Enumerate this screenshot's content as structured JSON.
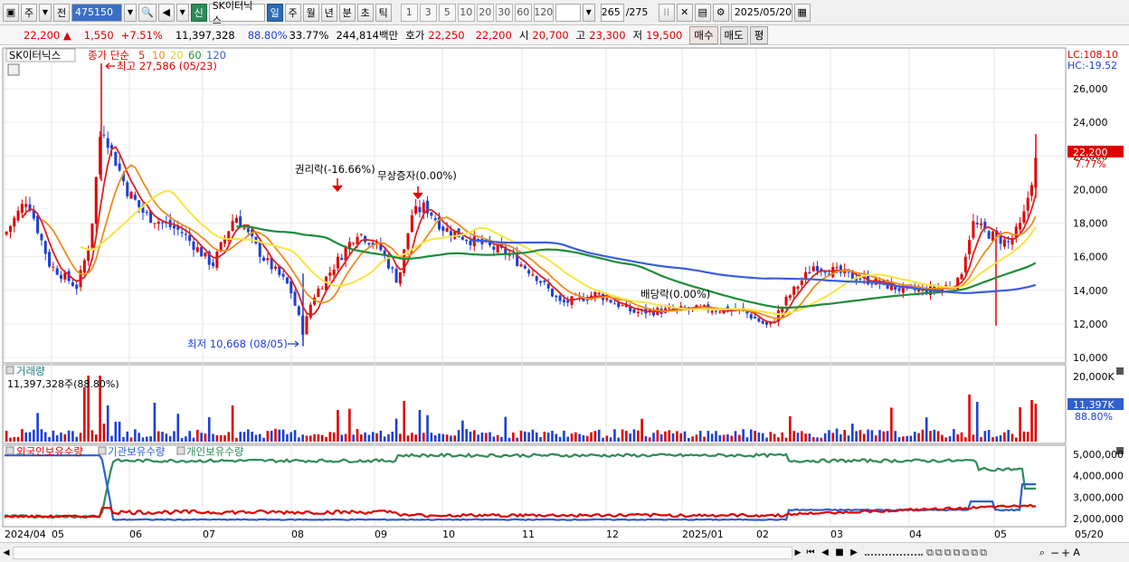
{
  "toolbar": {
    "period_label": "주",
    "prev_label": "전",
    "stock_code": "475150",
    "new_badge": "신",
    "stock_name": "SK이터닉스",
    "tabs": [
      "일",
      "주",
      "월",
      "년",
      "분",
      "초",
      "틱"
    ],
    "active_tab": "일",
    "periods": [
      "1",
      "3",
      "5",
      "10",
      "20",
      "30",
      "60",
      "120"
    ],
    "count": "265",
    "count_total": "/275",
    "date": "2025/05/20"
  },
  "info": {
    "price": "22,200",
    "change": "1,550",
    "change_pct": "+7.51%",
    "volume": "11,397,328",
    "vol_ratio": "88.80%",
    "turnover": "33.77%",
    "amount": "244,814백만",
    "quote_label": "호가",
    "ask": "22,250",
    "bid": "22,200",
    "open_label": "시",
    "open": "20,700",
    "high_label": "고",
    "high": "23,300",
    "low_label": "저",
    "low": "19,500",
    "buy_label": "매수",
    "sell_label": "매도",
    "avg_label": "평"
  },
  "price_panel": {
    "stock_label": "SK이터닉스",
    "legend_title": "종가 단순",
    "ma_labels": [
      "5",
      "10",
      "20",
      "60",
      "120"
    ],
    "lc": "LC:108.10",
    "hc": "HC:-19.52",
    "high_marker": "최고 27,586 (05/23)",
    "low_marker": "최저 10,668 (08/05)",
    "event_rights": "권리락(-16.66%)",
    "event_bonus": "무상증자(0.00%)",
    "event_dividend": "배당락(0.00%)",
    "y_ticks": [
      "26,000",
      "24,000",
      "22,000",
      "20,000",
      "18,000",
      "16,000",
      "14,000",
      "12,000",
      "10,000"
    ],
    "price_tag": "22,200",
    "price_pct": "7.77%"
  },
  "volume_panel": {
    "title": "거래량",
    "value_label": "11,397,328주(88.80%)",
    "y_tick": "20,000K",
    "tag": "11,397K",
    "tag_pct": "88.80%"
  },
  "holding_panel": {
    "legend": [
      "외국인보유수량",
      "기관보유수량",
      "개인보유수량"
    ],
    "y_ticks": [
      "5,000,000",
      "4,000,000",
      "3,000,000",
      "2,000,000"
    ]
  },
  "x_axis": [
    "2024/04",
    "05",
    "06",
    "07",
    "08",
    "09",
    "10",
    "11",
    "12",
    "2025/01",
    "02",
    "03",
    "04",
    "05",
    "05/20"
  ],
  "colors": {
    "up": "#e00000",
    "down": "#1d3fd6",
    "ma5": "#e02020",
    "ma10": "#f08c1e",
    "ma20": "#f5e642",
    "ma60": "#1e8c3a",
    "ma120": "#3a5fd8",
    "foreign": "#e00000",
    "institution": "#2f5fd0",
    "individual": "#2e8b57"
  },
  "chart_data": {
    "type": "line",
    "x": [
      "2024/04",
      "2024/05",
      "2024/06",
      "2024/07",
      "2024/08",
      "2024/09",
      "2024/10",
      "2024/11",
      "2024/12",
      "2025/01",
      "2025/02",
      "2025/03",
      "2025/04",
      "2025/05",
      "2025/05/20"
    ],
    "series": [
      {
        "name": "종가 단순",
        "values": [
          17500,
          19500,
          20500,
          18000,
          13500,
          17000,
          17800,
          15500,
          13000,
          12800,
          12000,
          15000,
          13800,
          17500,
          22200
        ]
      }
    ],
    "ylim": [
      10000,
      27000
    ]
  }
}
